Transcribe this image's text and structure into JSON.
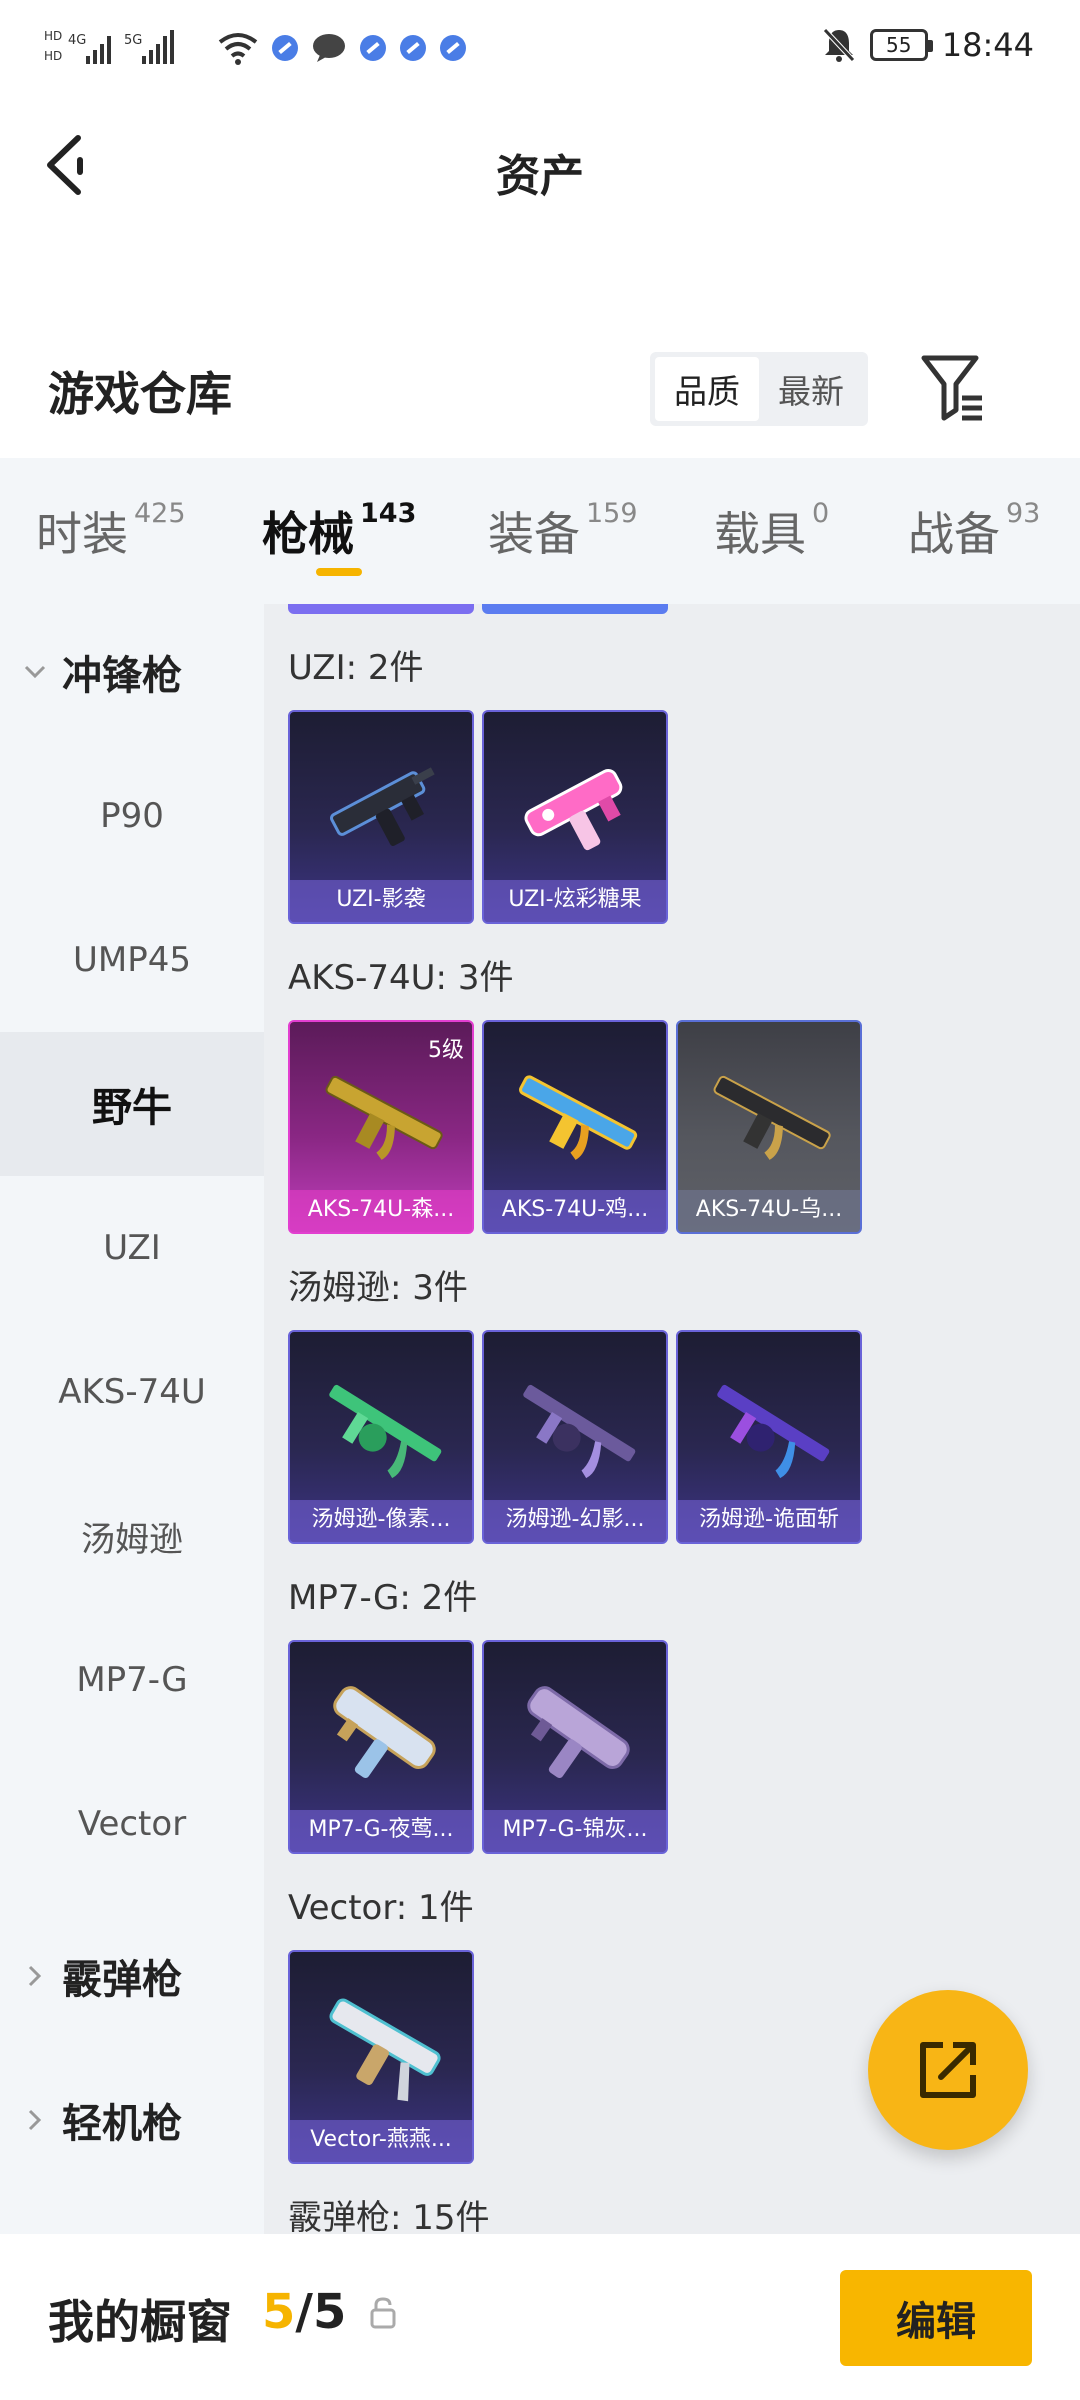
{
  "status_bar": {
    "left_signal": "HD 4G 5G",
    "battery": "55",
    "time": "18:44"
  },
  "header": {
    "title": "资产"
  },
  "warehouse": {
    "title": "游戏仓库",
    "sort_options": [
      "品质",
      "最新"
    ],
    "active_sort": "品质"
  },
  "tabs": [
    {
      "label": "时装",
      "count": "425"
    },
    {
      "label": "枪械",
      "count": "143"
    },
    {
      "label": "装备",
      "count": "159"
    },
    {
      "label": "载具",
      "count": "0"
    },
    {
      "label": "战备",
      "count": "93"
    }
  ],
  "sidebar": {
    "group_smg": "冲锋枪",
    "items": [
      "P90",
      "UMP45",
      "野牛",
      "UZI",
      "AKS-74U",
      "汤姆逊",
      "MP7-G",
      "Vector"
    ],
    "group_shotgun": "霰弹枪",
    "group_lmg": "轻机枪"
  },
  "sections": [
    {
      "title": "UZI: 2件",
      "cards": [
        {
          "name": "UZI-影袭",
          "style": "purple",
          "level": ""
        },
        {
          "name": "UZI-炫彩糖果",
          "style": "purple",
          "level": ""
        }
      ]
    },
    {
      "title": "AKS-74U: 3件",
      "cards": [
        {
          "name": "AKS-74U-森...",
          "style": "gold",
          "level": "5级"
        },
        {
          "name": "AKS-74U-鸡...",
          "style": "purple",
          "level": ""
        },
        {
          "name": "AKS-74U-乌...",
          "style": "grey",
          "level": ""
        }
      ]
    },
    {
      "title": "汤姆逊: 3件",
      "cards": [
        {
          "name": "汤姆逊-像素...",
          "style": "purple",
          "level": ""
        },
        {
          "name": "汤姆逊-幻影...",
          "style": "purple",
          "level": ""
        },
        {
          "name": "汤姆逊-诡面斩",
          "style": "purple",
          "level": ""
        }
      ]
    },
    {
      "title": "MP7-G: 2件",
      "cards": [
        {
          "name": "MP7-G-夜莺...",
          "style": "purple",
          "level": ""
        },
        {
          "name": "MP7-G-锦灰...",
          "style": "purple",
          "level": ""
        }
      ]
    },
    {
      "title": "Vector: 1件",
      "cards": [
        {
          "name": "Vector-燕燕...",
          "style": "purple",
          "level": ""
        }
      ]
    },
    {
      "title": "霰弹枪: 15件",
      "cards": []
    }
  ],
  "bottom": {
    "window_label": "我的橱窗",
    "window_current": "5",
    "window_sep": "/",
    "window_total": "5",
    "edit_label": "编辑"
  }
}
